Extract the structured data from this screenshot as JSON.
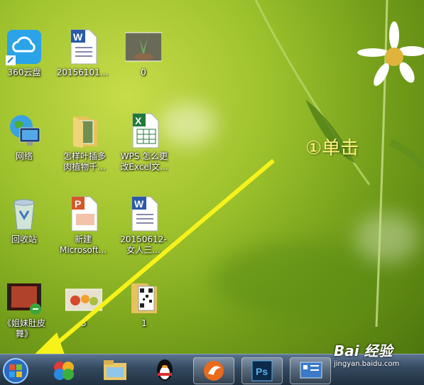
{
  "desktop_icons": [
    {
      "label": "360云盘",
      "icon": "cloud-drive-icon"
    },
    {
      "label": "20156101...",
      "icon": "word-document-icon"
    },
    {
      "label": "0",
      "icon": "photo-thumbnail-icon"
    },
    {
      "label": "网络",
      "icon": "network-globe-icon"
    },
    {
      "label": "怎样叶插多\n肉植物千...",
      "icon": "image-folder-icon"
    },
    {
      "label": "WPS 怎么更\n改Excel文...",
      "icon": "excel-document-icon"
    },
    {
      "label": "回收站",
      "icon": "recycle-bin-icon"
    },
    {
      "label": "新建\nMicrosoft...",
      "icon": "powerpoint-document-icon"
    },
    {
      "label": "20150612-\n女人三...",
      "icon": "word-document-icon"
    },
    {
      "label": "《姐妹肚皮\n舞》",
      "icon": "video-file-icon"
    },
    {
      "label": "3",
      "icon": "photo-thumbnail-icon"
    },
    {
      "label": "1",
      "icon": "qr-folder-icon"
    }
  ],
  "annotation": {
    "text": "①单击"
  },
  "taskbar": {
    "items": [
      {
        "name": "start",
        "icon": "windows-start-icon"
      },
      {
        "name": "colorful-app",
        "icon": "pinwheel-icon"
      },
      {
        "name": "explorer",
        "icon": "file-explorer-icon"
      },
      {
        "name": "qq",
        "icon": "qq-penguin-icon"
      },
      {
        "name": "browser",
        "icon": "browser-icon"
      },
      {
        "name": "photoshop",
        "icon": "photoshop-icon",
        "label": "Ps"
      },
      {
        "name": "control-panel",
        "icon": "control-panel-icon"
      }
    ]
  },
  "watermark": {
    "brand": "Bai 经验",
    "url": "jingyan.baidu.com"
  },
  "colors": {
    "arrow": "#f6f21a",
    "annotation": "#fff27a"
  }
}
